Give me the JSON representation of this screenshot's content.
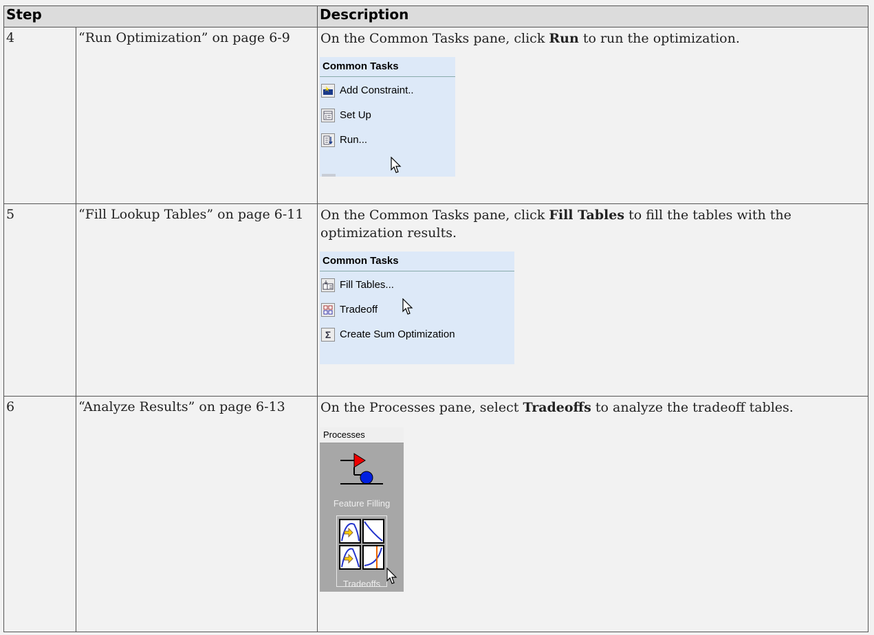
{
  "header": {
    "step": "Step",
    "description": "Description"
  },
  "rows": [
    {
      "number": "4",
      "link": "“Run Optimization” on page 6-9",
      "desc_before": "On the Common Tasks pane, click ",
      "desc_bold": "Run",
      "desc_after": " to run the optimization.",
      "panel_title": "Common Tasks",
      "items": [
        "Add Constraint..",
        "Set Up",
        "Run..."
      ]
    },
    {
      "number": "5",
      "link": "“Fill Lookup Tables” on page 6-11",
      "desc_before": "On the Common Tasks pane, click ",
      "desc_bold": "Fill Tables",
      "desc_after": " to fill the tables with the optimization results.",
      "panel_title": "Common Tasks",
      "items": [
        "Fill Tables...",
        "Tradeoff",
        "Create Sum Optimization"
      ]
    },
    {
      "number": "6",
      "link": "“Analyze Results” on page 6-13",
      "desc_before": "On the Processes pane, select ",
      "desc_bold": "Tradeoffs",
      "desc_after": " to analyze the tradeoff tables.",
      "panel_title": "Processes",
      "items": [
        "Feature Filling",
        "Tradeoffs"
      ]
    }
  ]
}
